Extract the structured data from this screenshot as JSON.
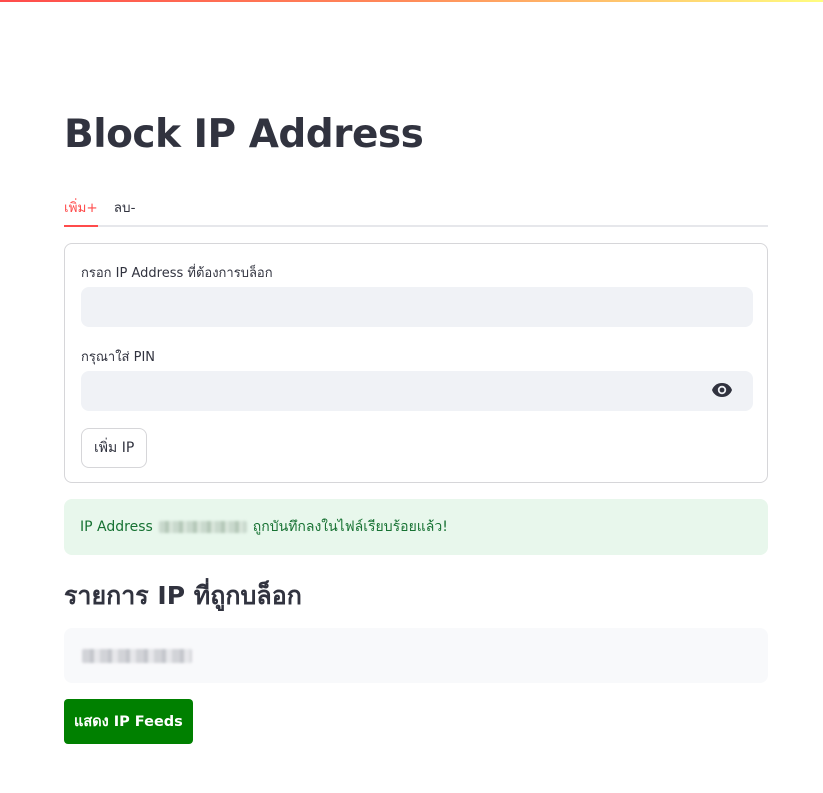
{
  "page": {
    "title": "Block IP Address"
  },
  "tabs": [
    {
      "label": "เพิ่ม+",
      "active": true
    },
    {
      "label": "ลบ-",
      "active": false
    }
  ],
  "form": {
    "ip_label": "กรอก IP Address ที่ต้องการบล็อก",
    "ip_value": "",
    "pin_label": "กรุณาใส่ PIN",
    "pin_value": "",
    "pin_toggle_icon": "eye-icon",
    "add_button_label": "เพิ่ม IP"
  },
  "alert": {
    "prefix": "IP Address",
    "suffix": "ถูกบันทึกลงในไฟล์เรียบร้อยแล้ว!",
    "color": "#177233",
    "background": "#e8f7ec"
  },
  "blocked_list": {
    "heading": "รายการ IP ที่ถูกบล็อก"
  },
  "feeds_button": {
    "label": "แสดง IP Feeds",
    "color": "#008000"
  },
  "colors": {
    "accent": "#ff4b4b",
    "text": "#31333f",
    "input_bg": "#f0f2f6"
  }
}
